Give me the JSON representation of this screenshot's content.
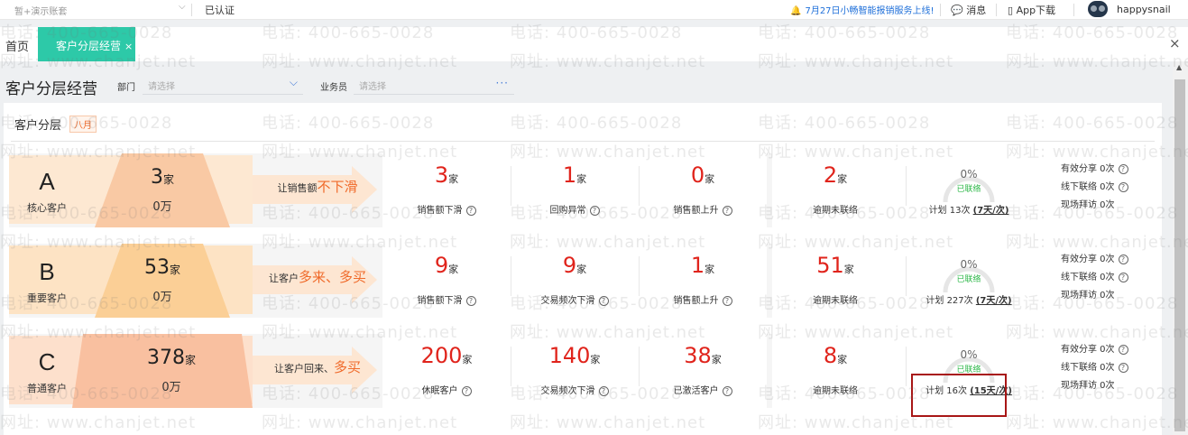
{
  "topbar": {
    "account_placeholder": "暂+演示账套",
    "verified": "已认证",
    "notice": "7月27日小畅智能报销服务上线!",
    "messages": "消息",
    "app_download": "App下载",
    "username": "happysnail"
  },
  "tabs": {
    "home": "首页",
    "active": "客户分层经营",
    "active_close": "×",
    "close_all": "×"
  },
  "header": {
    "title": "客户分层经营",
    "dept_label": "部门",
    "dept_placeholder": "请选择",
    "sales_label": "业务员",
    "sales_placeholder": "请选择"
  },
  "section": {
    "title": "客户分层",
    "month": "八月"
  },
  "watermark": {
    "phone": "电话: 400-665-0028",
    "site": "网址: www.chanjet.net"
  },
  "colors": {
    "accent": "#2dc9a8",
    "value_red": "#e0241c",
    "highlight_orange": "#f06a2a",
    "connected_green": "#2fb84a"
  },
  "tiers": [
    {
      "letter": "A",
      "name": "核心客户",
      "count": "3",
      "count_unit": "家",
      "amount": "0万",
      "slogan_prefix": "让销售额",
      "slogan_highlight": "不下滑",
      "metrics": [
        {
          "value": "3",
          "unit": "家",
          "label": "销售额下滑"
        },
        {
          "value": "1",
          "unit": "家",
          "label": "回购异常"
        },
        {
          "value": "0",
          "unit": "家",
          "label": "销售额上升"
        }
      ],
      "overdue": {
        "value": "2",
        "unit": "家",
        "label": "逾期未联络"
      },
      "gauge": {
        "percent": "0%",
        "state": "已联络"
      },
      "plan_text": "计划 13次",
      "plan_freq": "(7天/次)",
      "stats": [
        "有效分享 0次",
        "线下联络 0次",
        "现场拜访 0次"
      ]
    },
    {
      "letter": "B",
      "name": "重要客户",
      "count": "53",
      "count_unit": "家",
      "amount": "0万",
      "slogan_prefix": "让客户",
      "slogan_highlight": "多来、多买",
      "metrics": [
        {
          "value": "9",
          "unit": "家",
          "label": "销售额下滑"
        },
        {
          "value": "9",
          "unit": "家",
          "label": "交易频次下滑"
        },
        {
          "value": "1",
          "unit": "家",
          "label": "销售额上升"
        }
      ],
      "overdue": {
        "value": "51",
        "unit": "家",
        "label": "逾期未联络"
      },
      "gauge": {
        "percent": "0%",
        "state": "已联络"
      },
      "plan_text": "计划 227次",
      "plan_freq": "(7天/次)",
      "stats": [
        "有效分享 0次",
        "线下联络 0次",
        "现场拜访 0次"
      ]
    },
    {
      "letter": "C",
      "name": "普通客户",
      "count": "378",
      "count_unit": "家",
      "amount": "0万",
      "slogan_prefix": "让客户回来、",
      "slogan_highlight": "多买",
      "metrics": [
        {
          "value": "200",
          "unit": "家",
          "label": "休眠客户"
        },
        {
          "value": "140",
          "unit": "家",
          "label": "交易频次下滑"
        },
        {
          "value": "38",
          "unit": "家",
          "label": "已激活客户"
        }
      ],
      "overdue": {
        "value": "8",
        "unit": "家",
        "label": "逾期未联络"
      },
      "gauge": {
        "percent": "0%",
        "state": "已联络"
      },
      "plan_text": "计划 16次",
      "plan_freq": "(15天/次)",
      "stats": [
        "有效分享 0次",
        "线下联络 0次",
        "现场拜访 0次"
      ]
    }
  ]
}
